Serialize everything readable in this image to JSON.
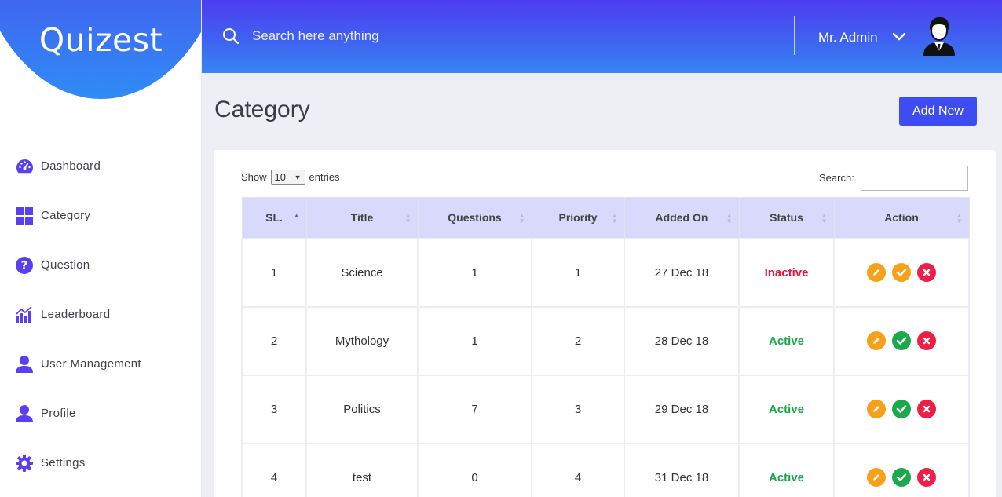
{
  "app": {
    "logo": "Quizest"
  },
  "sidebar": {
    "items": [
      {
        "label": "Dashboard",
        "icon": "dashboard-gauge-icon"
      },
      {
        "label": "Category",
        "icon": "grid-icon"
      },
      {
        "label": "Question",
        "icon": "question-circle-icon"
      },
      {
        "label": "Leaderboard",
        "icon": "bar-chart-icon"
      },
      {
        "label": "User Management",
        "icon": "user-icon"
      },
      {
        "label": "Profile",
        "icon": "user-icon"
      },
      {
        "label": "Settings",
        "icon": "gear-icon"
      }
    ]
  },
  "header": {
    "search_placeholder": "Search here anything",
    "user_name": "Mr. Admin"
  },
  "main": {
    "title": "Category",
    "add_button": "Add New",
    "show_label": "Show",
    "entries_value": "10",
    "entries_label": "entries",
    "search_label": "Search:"
  },
  "table": {
    "columns": [
      "SL.",
      "Title",
      "Questions",
      "Priority",
      "Added On",
      "Status",
      "Action"
    ],
    "rows": [
      {
        "sl": "1",
        "title": "Science",
        "questions": "1",
        "priority": "1",
        "added_on": "27 Dec 18",
        "status": "Inactive"
      },
      {
        "sl": "2",
        "title": "Mythology",
        "questions": "1",
        "priority": "2",
        "added_on": "28 Dec 18",
        "status": "Active"
      },
      {
        "sl": "3",
        "title": "Politics",
        "questions": "7",
        "priority": "3",
        "added_on": "29 Dec 18",
        "status": "Active"
      },
      {
        "sl": "4",
        "title": "test",
        "questions": "0",
        "priority": "4",
        "added_on": "31 Dec 18",
        "status": "Active"
      }
    ]
  },
  "colors": {
    "accent": "#3d4df2",
    "sidebar_icon": "#5a3ff0",
    "status_active": "#1aa84a",
    "status_inactive": "#e3143a",
    "action_edit": "#f7a11a",
    "action_delete": "#ee1f47"
  }
}
